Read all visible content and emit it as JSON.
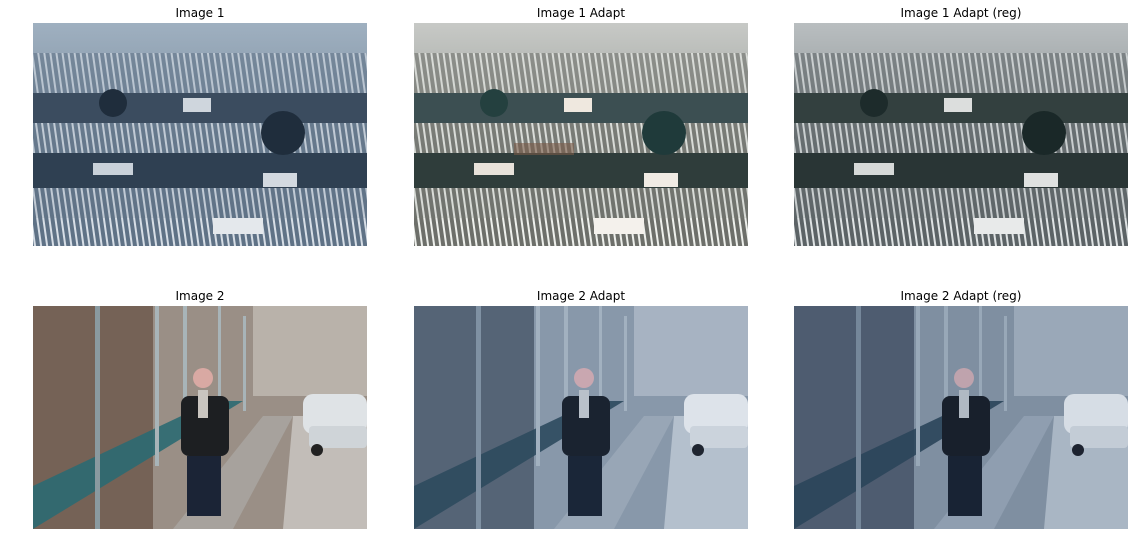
{
  "panels": [
    {
      "title": "Image 1",
      "scene": "snowy-vineyard-hillside",
      "tone": "original"
    },
    {
      "title": "Image 1 Adapt",
      "scene": "snowy-vineyard-hillside",
      "tone": "adapt"
    },
    {
      "title": "Image 1 Adapt (reg)",
      "scene": "snowy-vineyard-hillside",
      "tone": "adapt-reg"
    },
    {
      "title": "Image 2",
      "scene": "person-on-bridge-with-car",
      "tone": "original"
    },
    {
      "title": "Image 2 Adapt",
      "scene": "person-on-bridge-with-car",
      "tone": "adapt"
    },
    {
      "title": "Image 2 Adapt (reg)",
      "scene": "person-on-bridge-with-car",
      "tone": "adapt-reg"
    }
  ],
  "colors": {
    "figure_background": "#ffffff",
    "title_text": "#000000"
  }
}
